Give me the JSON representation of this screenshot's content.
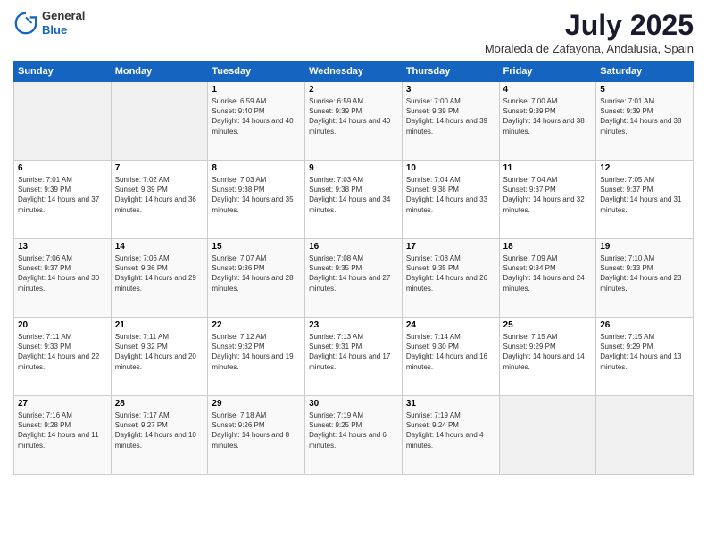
{
  "header": {
    "logo_general": "General",
    "logo_blue": "Blue",
    "month_title": "July 2025",
    "location": "Moraleda de Zafayona, Andalusia, Spain"
  },
  "days_of_week": [
    "Sunday",
    "Monday",
    "Tuesday",
    "Wednesday",
    "Thursday",
    "Friday",
    "Saturday"
  ],
  "weeks": [
    [
      {
        "day": "",
        "sunrise": "",
        "sunset": "",
        "daylight": ""
      },
      {
        "day": "",
        "sunrise": "",
        "sunset": "",
        "daylight": ""
      },
      {
        "day": "1",
        "sunrise": "Sunrise: 6:59 AM",
        "sunset": "Sunset: 9:40 PM",
        "daylight": "Daylight: 14 hours and 40 minutes."
      },
      {
        "day": "2",
        "sunrise": "Sunrise: 6:59 AM",
        "sunset": "Sunset: 9:39 PM",
        "daylight": "Daylight: 14 hours and 40 minutes."
      },
      {
        "day": "3",
        "sunrise": "Sunrise: 7:00 AM",
        "sunset": "Sunset: 9:39 PM",
        "daylight": "Daylight: 14 hours and 39 minutes."
      },
      {
        "day": "4",
        "sunrise": "Sunrise: 7:00 AM",
        "sunset": "Sunset: 9:39 PM",
        "daylight": "Daylight: 14 hours and 38 minutes."
      },
      {
        "day": "5",
        "sunrise": "Sunrise: 7:01 AM",
        "sunset": "Sunset: 9:39 PM",
        "daylight": "Daylight: 14 hours and 38 minutes."
      }
    ],
    [
      {
        "day": "6",
        "sunrise": "Sunrise: 7:01 AM",
        "sunset": "Sunset: 9:39 PM",
        "daylight": "Daylight: 14 hours and 37 minutes."
      },
      {
        "day": "7",
        "sunrise": "Sunrise: 7:02 AM",
        "sunset": "Sunset: 9:39 PM",
        "daylight": "Daylight: 14 hours and 36 minutes."
      },
      {
        "day": "8",
        "sunrise": "Sunrise: 7:03 AM",
        "sunset": "Sunset: 9:38 PM",
        "daylight": "Daylight: 14 hours and 35 minutes."
      },
      {
        "day": "9",
        "sunrise": "Sunrise: 7:03 AM",
        "sunset": "Sunset: 9:38 PM",
        "daylight": "Daylight: 14 hours and 34 minutes."
      },
      {
        "day": "10",
        "sunrise": "Sunrise: 7:04 AM",
        "sunset": "Sunset: 9:38 PM",
        "daylight": "Daylight: 14 hours and 33 minutes."
      },
      {
        "day": "11",
        "sunrise": "Sunrise: 7:04 AM",
        "sunset": "Sunset: 9:37 PM",
        "daylight": "Daylight: 14 hours and 32 minutes."
      },
      {
        "day": "12",
        "sunrise": "Sunrise: 7:05 AM",
        "sunset": "Sunset: 9:37 PM",
        "daylight": "Daylight: 14 hours and 31 minutes."
      }
    ],
    [
      {
        "day": "13",
        "sunrise": "Sunrise: 7:06 AM",
        "sunset": "Sunset: 9:37 PM",
        "daylight": "Daylight: 14 hours and 30 minutes."
      },
      {
        "day": "14",
        "sunrise": "Sunrise: 7:06 AM",
        "sunset": "Sunset: 9:36 PM",
        "daylight": "Daylight: 14 hours and 29 minutes."
      },
      {
        "day": "15",
        "sunrise": "Sunrise: 7:07 AM",
        "sunset": "Sunset: 9:36 PM",
        "daylight": "Daylight: 14 hours and 28 minutes."
      },
      {
        "day": "16",
        "sunrise": "Sunrise: 7:08 AM",
        "sunset": "Sunset: 9:35 PM",
        "daylight": "Daylight: 14 hours and 27 minutes."
      },
      {
        "day": "17",
        "sunrise": "Sunrise: 7:08 AM",
        "sunset": "Sunset: 9:35 PM",
        "daylight": "Daylight: 14 hours and 26 minutes."
      },
      {
        "day": "18",
        "sunrise": "Sunrise: 7:09 AM",
        "sunset": "Sunset: 9:34 PM",
        "daylight": "Daylight: 14 hours and 24 minutes."
      },
      {
        "day": "19",
        "sunrise": "Sunrise: 7:10 AM",
        "sunset": "Sunset: 9:33 PM",
        "daylight": "Daylight: 14 hours and 23 minutes."
      }
    ],
    [
      {
        "day": "20",
        "sunrise": "Sunrise: 7:11 AM",
        "sunset": "Sunset: 9:33 PM",
        "daylight": "Daylight: 14 hours and 22 minutes."
      },
      {
        "day": "21",
        "sunrise": "Sunrise: 7:11 AM",
        "sunset": "Sunset: 9:32 PM",
        "daylight": "Daylight: 14 hours and 20 minutes."
      },
      {
        "day": "22",
        "sunrise": "Sunrise: 7:12 AM",
        "sunset": "Sunset: 9:32 PM",
        "daylight": "Daylight: 14 hours and 19 minutes."
      },
      {
        "day": "23",
        "sunrise": "Sunrise: 7:13 AM",
        "sunset": "Sunset: 9:31 PM",
        "daylight": "Daylight: 14 hours and 17 minutes."
      },
      {
        "day": "24",
        "sunrise": "Sunrise: 7:14 AM",
        "sunset": "Sunset: 9:30 PM",
        "daylight": "Daylight: 14 hours and 16 minutes."
      },
      {
        "day": "25",
        "sunrise": "Sunrise: 7:15 AM",
        "sunset": "Sunset: 9:29 PM",
        "daylight": "Daylight: 14 hours and 14 minutes."
      },
      {
        "day": "26",
        "sunrise": "Sunrise: 7:15 AM",
        "sunset": "Sunset: 9:29 PM",
        "daylight": "Daylight: 14 hours and 13 minutes."
      }
    ],
    [
      {
        "day": "27",
        "sunrise": "Sunrise: 7:16 AM",
        "sunset": "Sunset: 9:28 PM",
        "daylight": "Daylight: 14 hours and 11 minutes."
      },
      {
        "day": "28",
        "sunrise": "Sunrise: 7:17 AM",
        "sunset": "Sunset: 9:27 PM",
        "daylight": "Daylight: 14 hours and 10 minutes."
      },
      {
        "day": "29",
        "sunrise": "Sunrise: 7:18 AM",
        "sunset": "Sunset: 9:26 PM",
        "daylight": "Daylight: 14 hours and 8 minutes."
      },
      {
        "day": "30",
        "sunrise": "Sunrise: 7:19 AM",
        "sunset": "Sunset: 9:25 PM",
        "daylight": "Daylight: 14 hours and 6 minutes."
      },
      {
        "day": "31",
        "sunrise": "Sunrise: 7:19 AM",
        "sunset": "Sunset: 9:24 PM",
        "daylight": "Daylight: 14 hours and 4 minutes."
      },
      {
        "day": "",
        "sunrise": "",
        "sunset": "",
        "daylight": ""
      },
      {
        "day": "",
        "sunrise": "",
        "sunset": "",
        "daylight": ""
      }
    ]
  ]
}
